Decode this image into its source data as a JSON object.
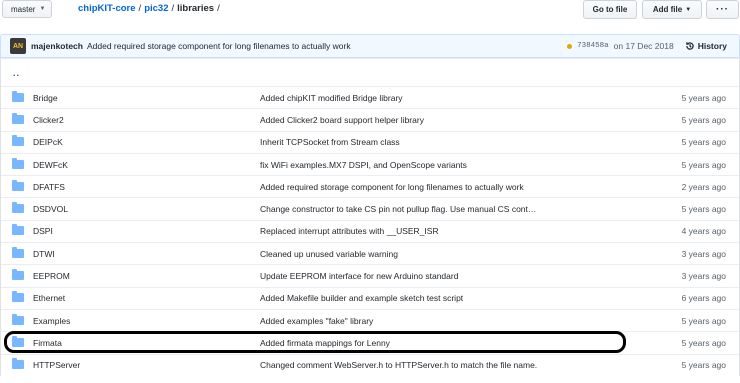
{
  "branch": {
    "label": "master"
  },
  "breadcrumb": {
    "repo": "chipKIT-core",
    "folder": "pic32",
    "current": "libraries",
    "sep": "/"
  },
  "buttons": {
    "go_to_file": "Go to file",
    "add_file": "Add file",
    "more": "···"
  },
  "commit": {
    "avatar_text": "AN",
    "author": "majenkotech",
    "message": "Added required storage component for long filenames to actually work",
    "sha": "738458a",
    "date": "on 17 Dec 2018",
    "history_label": "History"
  },
  "parent_link": "..",
  "files": [
    {
      "name": "Bridge",
      "message": "Added chipKIT modified Bridge library",
      "age": "5 years ago"
    },
    {
      "name": "Clicker2",
      "message": "Added Clicker2 board support helper library",
      "age": "5 years ago"
    },
    {
      "name": "DEIPcK",
      "message": "Inherit TCPSocket from Stream class",
      "age": "5 years ago"
    },
    {
      "name": "DEWFcK",
      "message": "fix WiFi examples.MX7 DSPI, and OpenScope variants",
      "age": "5 years ago"
    },
    {
      "name": "DFATFS",
      "message": "Added required storage component for long filenames to actually work",
      "age": "2 years ago"
    },
    {
      "name": "DSDVOL",
      "message": "Change constructor to take CS pin not pullup flag. Use manual CS cont…",
      "age": "5 years ago"
    },
    {
      "name": "DSPI",
      "message": "Replaced interrupt attributes with __USER_ISR",
      "age": "4 years ago"
    },
    {
      "name": "DTWI",
      "message": "Cleaned up unused variable warning",
      "age": "3 years ago"
    },
    {
      "name": "EEPROM",
      "message": "Update EEPROM interface for new Arduino standard",
      "age": "3 years ago"
    },
    {
      "name": "Ethernet",
      "message": "Added Makefile builder and example sketch test script",
      "age": "6 years ago"
    },
    {
      "name": "Examples",
      "message": "Added examples \"fake\" library",
      "age": "5 years ago"
    },
    {
      "name": "Firmata",
      "message": "Added firmata mappings for Lenny",
      "age": "5 years ago"
    },
    {
      "name": "HTTPServer",
      "message": "Changed comment WebServer.h to HTTPServer.h to match the file name.",
      "age": "5 years ago"
    }
  ],
  "colors": {
    "link": "#0366d6",
    "folder": "#79b8ff",
    "commit_bg": "#f1f8ff",
    "status": "#dbab09"
  }
}
